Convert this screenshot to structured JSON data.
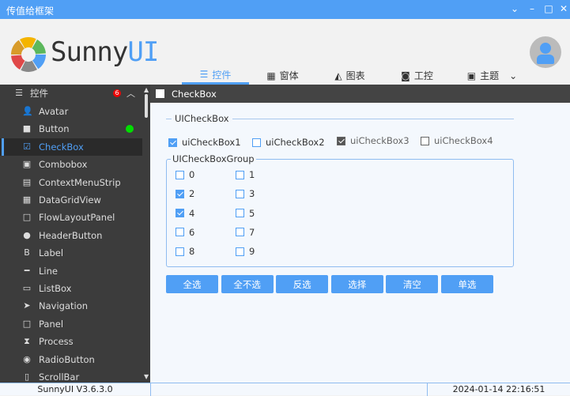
{
  "window": {
    "title": "传值给框架",
    "controls": [
      "⌄",
      "–",
      "□",
      "✕"
    ]
  },
  "logo": {
    "text_dark": "Sunny",
    "text_blue": "UI",
    "colors": [
      "#f4b400",
      "#5cb85c",
      "#509ff5",
      "#888888",
      "#e04848",
      "#d89b2a"
    ]
  },
  "tabs": [
    {
      "label": "控件",
      "icon": "list-icon",
      "active": true
    },
    {
      "label": "窗体",
      "icon": "windows-icon"
    },
    {
      "label": "图表",
      "icon": "chart-icon"
    },
    {
      "label": "工控",
      "icon": "gauge-icon"
    },
    {
      "label": "主题",
      "icon": "image-icon"
    }
  ],
  "sidebar": {
    "header": {
      "label": "控件",
      "badge": "6"
    },
    "items": [
      {
        "label": "Avatar",
        "icon": "👤"
      },
      {
        "label": "Button",
        "icon": "■",
        "dot": true
      },
      {
        "label": "CheckBox",
        "icon": "☑",
        "selected": true
      },
      {
        "label": "Combobox",
        "icon": "▣"
      },
      {
        "label": "ContextMenuStrip",
        "icon": "▤"
      },
      {
        "label": "DataGridView",
        "icon": "▦"
      },
      {
        "label": "FlowLayoutPanel",
        "icon": "□"
      },
      {
        "label": "HeaderButton",
        "icon": "●"
      },
      {
        "label": "Label",
        "icon": "B"
      },
      {
        "label": "Line",
        "icon": "━"
      },
      {
        "label": "ListBox",
        "icon": "▭"
      },
      {
        "label": "Navigation",
        "icon": "➤"
      },
      {
        "label": "Panel",
        "icon": "□"
      },
      {
        "label": "Process",
        "icon": "⧗"
      },
      {
        "label": "RadioButton",
        "icon": "◉"
      },
      {
        "label": "ScrollBar",
        "icon": "▯"
      }
    ]
  },
  "page": {
    "title": "CheckBox",
    "checkbox_section": {
      "title": "UICheckBox",
      "items": [
        {
          "label": "uiCheckBox1",
          "checked": true
        },
        {
          "label": "uiCheckBox2",
          "checked": false
        },
        {
          "label": "uiCheckBox3",
          "checked": true,
          "disabled": true
        },
        {
          "label": "uiCheckBox4",
          "checked": false,
          "disabled": true
        }
      ]
    },
    "group": {
      "title": "UICheckBoxGroup",
      "items": [
        {
          "label": "0",
          "checked": false
        },
        {
          "label": "1",
          "checked": false
        },
        {
          "label": "2",
          "checked": true
        },
        {
          "label": "3",
          "checked": false
        },
        {
          "label": "4",
          "checked": true
        },
        {
          "label": "5",
          "checked": false
        },
        {
          "label": "6",
          "checked": false
        },
        {
          "label": "7",
          "checked": false
        },
        {
          "label": "8",
          "checked": false
        },
        {
          "label": "9",
          "checked": false
        }
      ]
    },
    "buttons": [
      "全选",
      "全不选",
      "反选",
      "选择",
      "清空",
      "单选"
    ]
  },
  "status": {
    "version": "SunnyUI V3.6.3.0",
    "datetime": "2024-01-14 22:16:51"
  },
  "colors": {
    "accent": "#509ff5",
    "sidebar": "#3c3c3c"
  }
}
